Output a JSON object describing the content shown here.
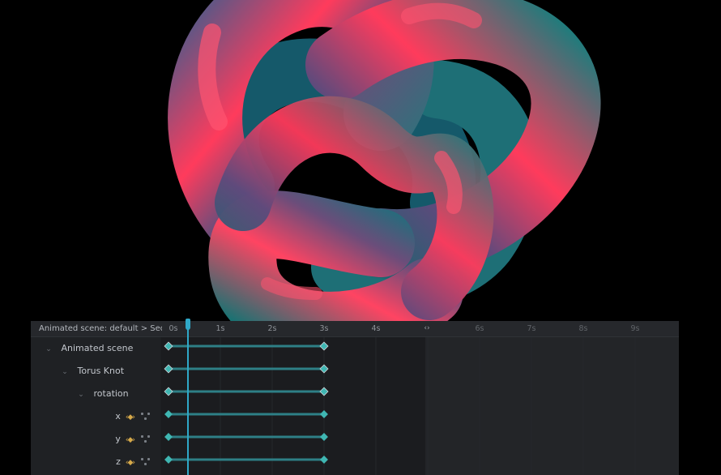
{
  "sequence_editor": {
    "breadcrumb": "Animated scene: default > Sequence",
    "range_toggle_glyph": "‹›",
    "timeline_ticks": [
      "0s",
      "1s",
      "2s",
      "3s",
      "4s",
      "6s",
      "7s",
      "8s",
      "9s"
    ],
    "playhead_time_s": 0.35,
    "tree": {
      "sheet": "Animated scene",
      "object": "Torus Knot",
      "prop_group": "rotation",
      "props": [
        "x",
        "y",
        "z"
      ]
    },
    "keyframes_s": [
      0,
      3
    ],
    "icons": {
      "chevron": "chevron-down-icon",
      "keyframe_nav": "keyframe-nav-icon",
      "graph_editor": "graph-editor-icon"
    },
    "keyframe_nav_glyph": "‹◆›",
    "chevron_glyph": "⌄"
  },
  "colors": {
    "accent": "#2fa8c8",
    "keyframe": "#3fb6b2",
    "track_line": "#2e7f86",
    "nav_icon": "#d6a94a",
    "knot_pink": "#ff3b5c",
    "knot_teal": "#1e7c7c",
    "knot_purple": "#6b4d7a"
  }
}
